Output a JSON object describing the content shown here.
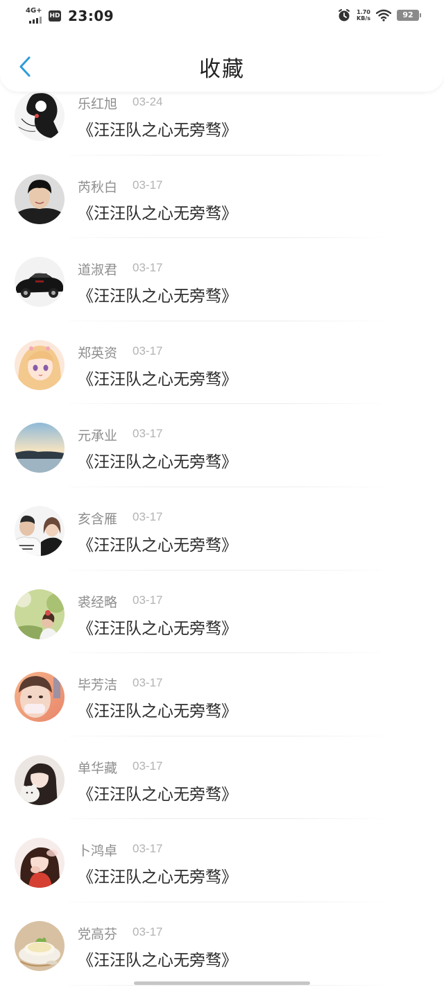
{
  "status_bar": {
    "network": "4G+",
    "hd": "HD",
    "time": "23:09",
    "speed_value": "1.70",
    "speed_unit": "KB/s",
    "battery": "92",
    "icons": [
      "signal-icon",
      "alarm-icon",
      "wifi-icon",
      "battery-icon"
    ]
  },
  "header": {
    "title": "收藏",
    "back_icon": "chevron-left-icon",
    "accent": "#2d9cdb"
  },
  "favorites": [
    {
      "name": "乐红旭",
      "date": "03-24",
      "title": "《汪汪队之心无旁骛》",
      "avatar": "avatar-sketch-girl"
    },
    {
      "name": "芮秋白",
      "date": "03-17",
      "title": "《汪汪队之心无旁骛》",
      "avatar": "avatar-young-man"
    },
    {
      "name": "道淑君",
      "date": "03-17",
      "title": "《汪汪队之心无旁骛》",
      "avatar": "avatar-classic-car"
    },
    {
      "name": "郑英资",
      "date": "03-17",
      "title": "《汪汪队之心无旁骛》",
      "avatar": "avatar-anime-girl"
    },
    {
      "name": "元承业",
      "date": "03-17",
      "title": "《汪汪队之心无旁骛》",
      "avatar": "avatar-landscape"
    },
    {
      "name": "亥含雁",
      "date": "03-17",
      "title": "《汪汪队之心无旁骛》",
      "avatar": "avatar-couple"
    },
    {
      "name": "裘经略",
      "date": "03-17",
      "title": "《汪汪队之心无旁骛》",
      "avatar": "avatar-garden-girl"
    },
    {
      "name": "毕芳洁",
      "date": "03-17",
      "title": "《汪汪队之心无旁骛》",
      "avatar": "avatar-sunset-face"
    },
    {
      "name": "单华藏",
      "date": "03-17",
      "title": "《汪汪队之心无旁骛》",
      "avatar": "avatar-girl-plush"
    },
    {
      "name": "卜鸿卓",
      "date": "03-17",
      "title": "《汪汪队之心无旁骛》",
      "avatar": "avatar-girl-red"
    },
    {
      "name": "党高芬",
      "date": "03-17",
      "title": "《汪汪队之心无旁骛》",
      "avatar": "avatar-dessert"
    }
  ]
}
